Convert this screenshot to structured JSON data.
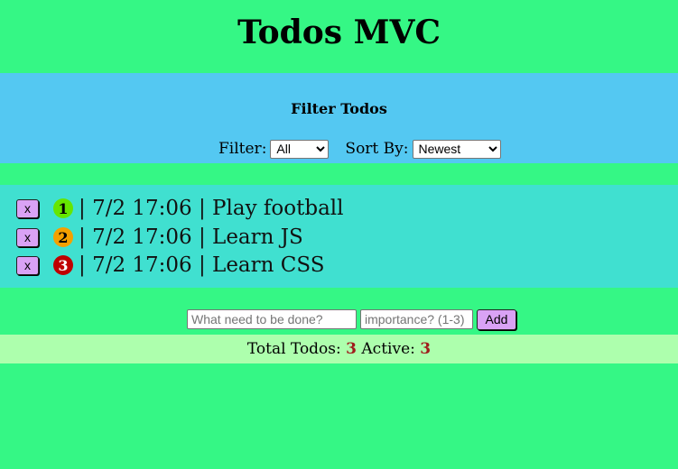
{
  "app": {
    "title": "Todos MVC"
  },
  "filter": {
    "heading": "Filter Todos",
    "filter_label": "Filter:",
    "filter_value": "All",
    "sort_label": "Sort By:",
    "sort_value": "Newest"
  },
  "todos": [
    {
      "delete_label": "x",
      "importance": "1",
      "importance_color": "#66e600",
      "importance_text_color": "#000000",
      "separator": "|",
      "timestamp": "7/2 17:06",
      "text": "Play football"
    },
    {
      "delete_label": "x",
      "importance": "2",
      "importance_color": "#f5a000",
      "importance_text_color": "#000000",
      "separator": "|",
      "timestamp": "7/2 17:06",
      "text": "Learn JS"
    },
    {
      "delete_label": "x",
      "importance": "3",
      "importance_color": "#c00000",
      "importance_text_color": "#ffffff",
      "separator": "|",
      "timestamp": "7/2 17:06",
      "text": "Learn CSS"
    }
  ],
  "add_form": {
    "text_placeholder": "What need to be done?",
    "importance_placeholder": "importance? (1-3)",
    "add_label": "Add"
  },
  "stats": {
    "total_label": "Total Todos:",
    "total_value": "3",
    "active_label": "Active:",
    "active_value": "3"
  },
  "colors": {
    "page_bg": "#35f785",
    "filter_bg": "#54c8f2",
    "list_bg": "#40e0d0",
    "stats_bg": "#adffad",
    "button_bg": "#d9a2f5",
    "count_color": "#a01c1c"
  }
}
